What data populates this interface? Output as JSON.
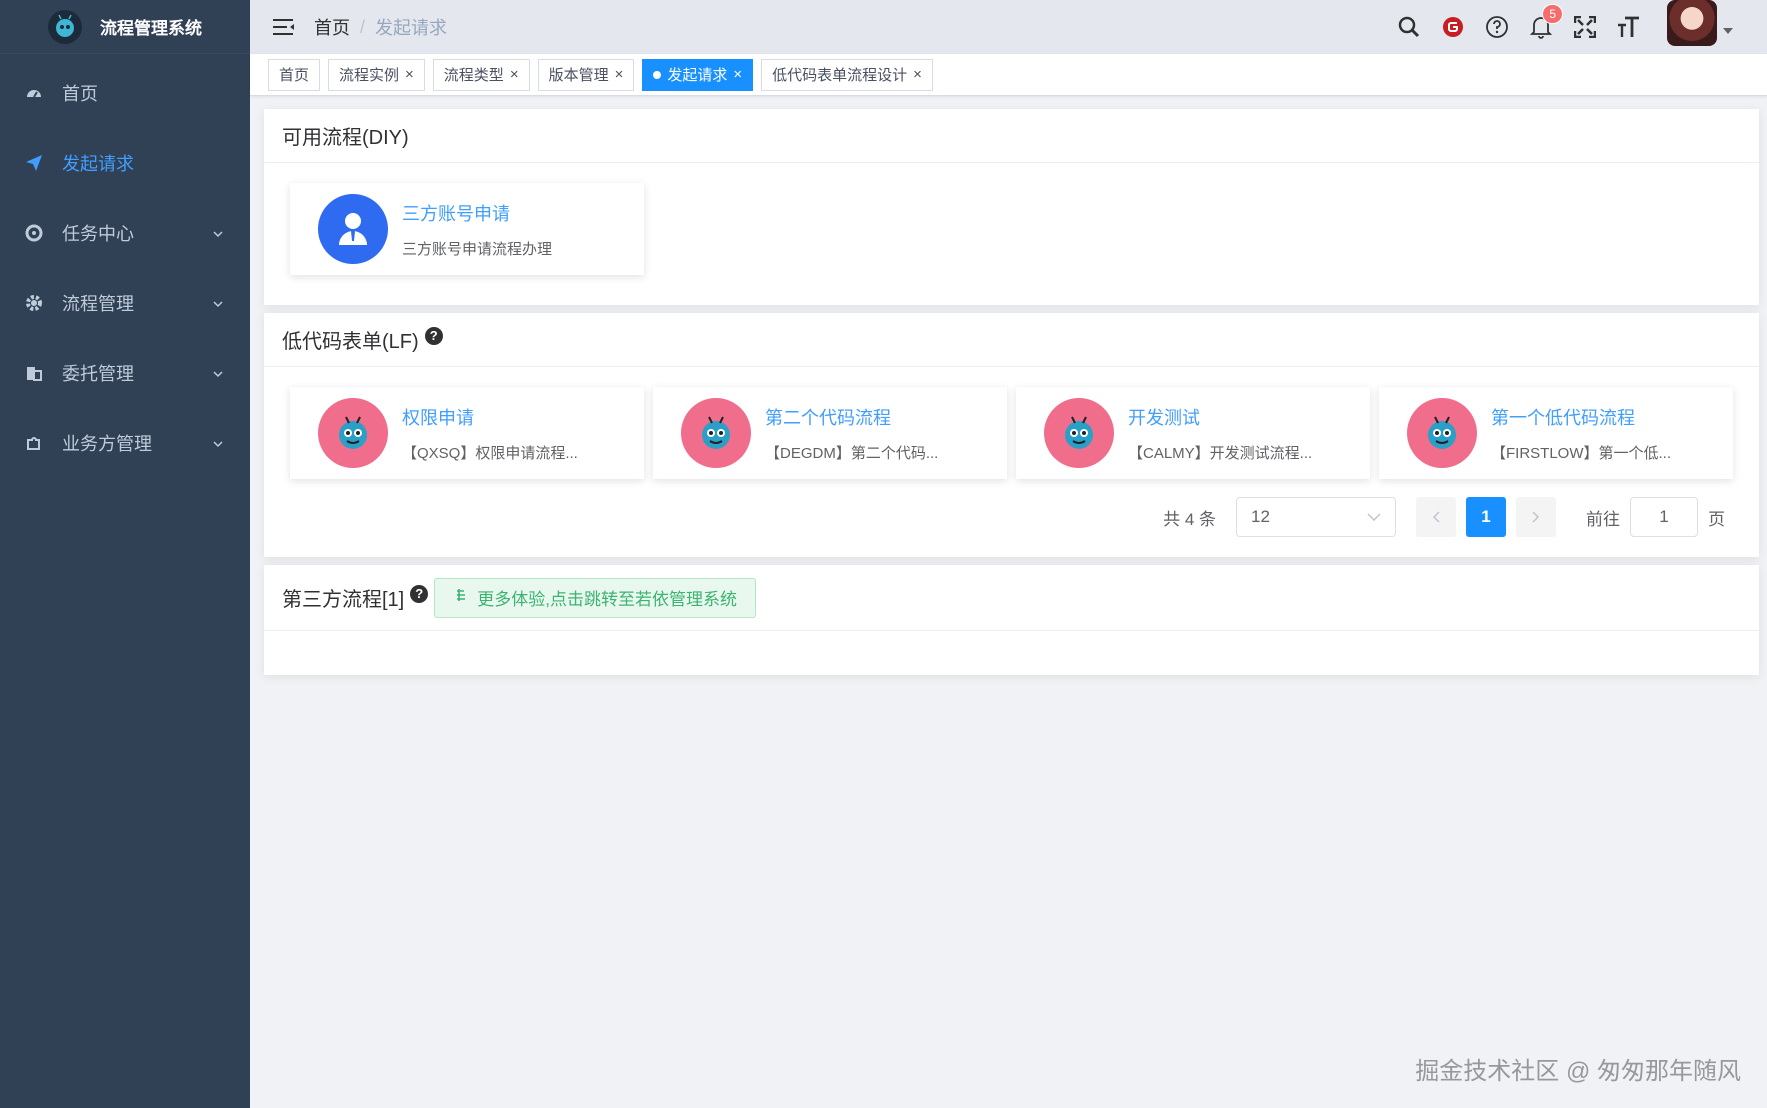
{
  "app": {
    "title": "流程管理系统"
  },
  "sidebar": {
    "items": [
      {
        "label": "首页",
        "icon": "dashboard-icon",
        "active": false,
        "expandable": false
      },
      {
        "label": "发起请求",
        "icon": "paper-plane-icon",
        "active": true,
        "expandable": false
      },
      {
        "label": "任务中心",
        "icon": "task-icon",
        "active": false,
        "expandable": true
      },
      {
        "label": "流程管理",
        "icon": "gear-icon",
        "active": false,
        "expandable": true
      },
      {
        "label": "委托管理",
        "icon": "delegate-icon",
        "active": false,
        "expandable": true
      },
      {
        "label": "业务方管理",
        "icon": "puzzle-icon",
        "active": false,
        "expandable": true
      }
    ]
  },
  "navbar": {
    "breadcrumb": [
      "首页",
      "发起请求"
    ],
    "breadcrumb_sep": "/",
    "notification_count": "5"
  },
  "tags": [
    {
      "label": "首页",
      "closable": false,
      "active": false
    },
    {
      "label": "流程实例",
      "closable": true,
      "active": false
    },
    {
      "label": "流程类型",
      "closable": true,
      "active": false
    },
    {
      "label": "版本管理",
      "closable": true,
      "active": false
    },
    {
      "label": "发起请求",
      "closable": true,
      "active": true
    },
    {
      "label": "低代码表单流程设计",
      "closable": true,
      "active": false
    }
  ],
  "sections": {
    "diy": {
      "title": "可用流程(DIY)",
      "items": [
        {
          "title": "三方账号申请",
          "desc": "三方账号申请流程办理"
        }
      ]
    },
    "lf": {
      "title": "低代码表单(LF)",
      "items": [
        {
          "title": "权限申请",
          "desc": "【QXSQ】权限申请流程..."
        },
        {
          "title": "第二个代码流程",
          "desc": "【DEGDM】第二个代码..."
        },
        {
          "title": "开发测试",
          "desc": "【CALMY】开发测试流程..."
        },
        {
          "title": "第一个低代码流程",
          "desc": "【FIRSTLOW】第一个低..."
        }
      ],
      "pagination": {
        "total_label": "共 4 条",
        "page_size": "12",
        "current_page": "1",
        "goto_label": "前往",
        "goto_value": "1",
        "page_unit": "页"
      }
    },
    "third": {
      "title": "第三方流程[1]",
      "button_label": "更多体验,点击跳转至若依管理系统"
    }
  },
  "watermark": "掘金技术社区 @ 匆匆那年随风",
  "colors": {
    "sidebar_bg": "#304156",
    "accent": "#1890ff",
    "link": "#409eff"
  }
}
